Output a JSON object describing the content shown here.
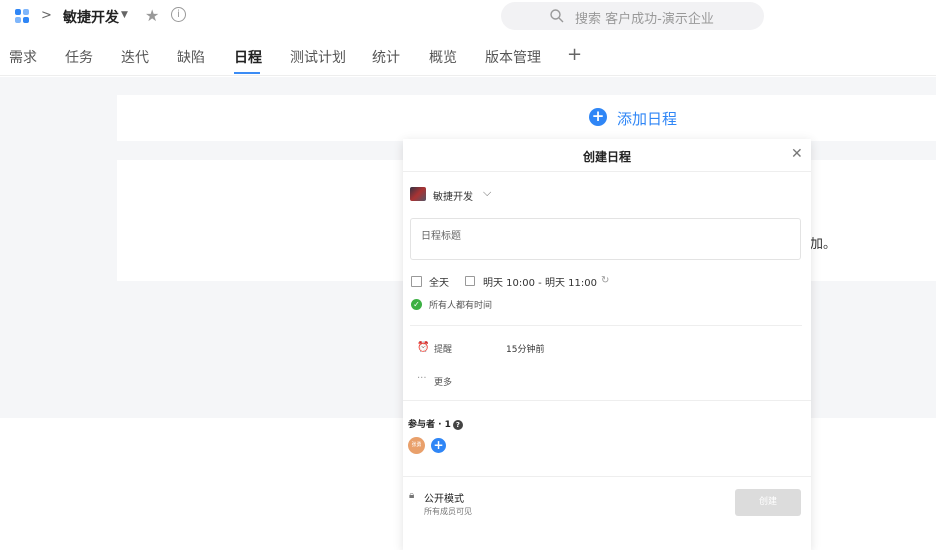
{
  "header": {
    "project_name": "敏捷开发",
    "breadcrumb_sep": ">",
    "info_glyph": "i",
    "search_placeholder": "搜索 客户成功-演示企业"
  },
  "tabs": [
    {
      "label": "需求"
    },
    {
      "label": "任务"
    },
    {
      "label": "迭代"
    },
    {
      "label": "缺陷"
    },
    {
      "label": "日程",
      "active": true
    },
    {
      "label": "测试计划"
    },
    {
      "label": "统计"
    },
    {
      "label": "概览"
    },
    {
      "label": "版本管理"
    }
  ],
  "add_tab_glyph": "+",
  "main": {
    "add_schedule_label": "添加日程",
    "background_text_fragment": "加。"
  },
  "modal": {
    "title": "创建日程",
    "project_name": "敏捷开发",
    "title_placeholder": "日程标题",
    "all_day_label": "全天",
    "time_range": "明天 10:00 - 明天 11:00",
    "availability": "所有人都有时间",
    "reminder_label": "提醒",
    "reminder_value": "15分钟前",
    "more_label": "更多",
    "participants_label": "参与者 · 1",
    "participant_avatar_text": "张勇",
    "public_mode_label": "公开模式",
    "public_mode_desc": "所有成员可见",
    "create_button": "创建"
  },
  "colors": {
    "accent": "#2f86f6",
    "success": "#3cb043",
    "disabled_button": "#dcdcdc",
    "page_bg": "#f5f6f8"
  }
}
